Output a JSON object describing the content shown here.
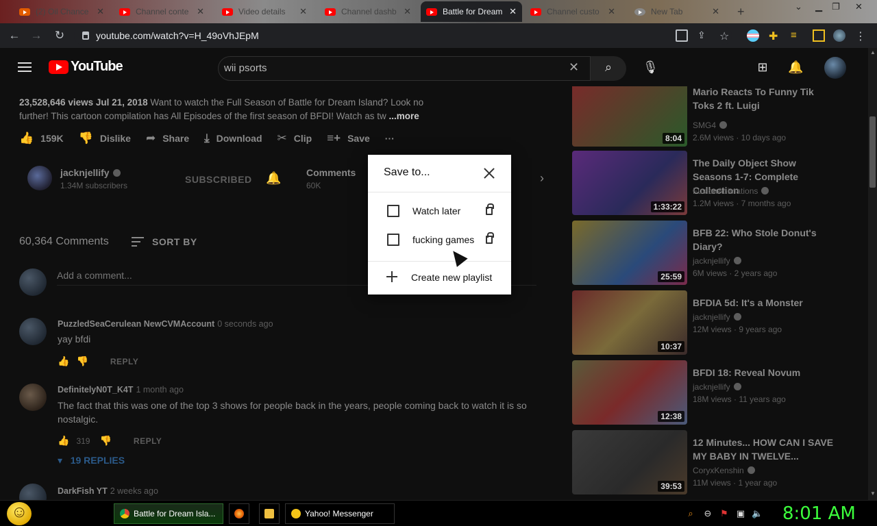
{
  "browser": {
    "tabs": [
      {
        "label": "(2) Oil Chance",
        "active": false
      },
      {
        "label": "Channel conte",
        "active": false
      },
      {
        "label": "Video details",
        "active": false
      },
      {
        "label": "Channel dashb",
        "active": false
      },
      {
        "label": "Battle for Dream",
        "active": true
      },
      {
        "label": "Channel custo",
        "active": false
      },
      {
        "label": "New Tab",
        "active": false
      }
    ],
    "new_tab_label": "+",
    "url": "youtube.com/watch?v=H_49oVhJEpM"
  },
  "header": {
    "logo_text": "YouTube",
    "search_value": "wii psorts"
  },
  "video": {
    "description_stats": "23,528,646 views  Jul 21, 2018",
    "description_text": "Want to watch the Full Season of Battle for Dream Island? Look no further! This cartoon compilation has All Episodes of the first season of BFDI! Watch as tw",
    "description_more": "...more",
    "actions": {
      "likes": "159K",
      "dislike": "Dislike",
      "share": "Share",
      "download": "Download",
      "clip": "Clip",
      "save": "Save",
      "more": "···"
    },
    "channel": {
      "name": "jacknjellify",
      "subscribers": "1.34M subscribers",
      "subscribed_label": "SUBSCRIBED"
    },
    "comments_chip": {
      "label": "Comments",
      "count": "60K"
    }
  },
  "comments": {
    "count_label": "60,364 Comments",
    "sort_label": "SORT BY",
    "add_placeholder": "Add a comment...",
    "items": [
      {
        "author": "PuzzledSeaCerulean NewCVMAccount",
        "time": "0 seconds ago",
        "text": "yay bfdi",
        "likes": "",
        "reply": "REPLY"
      },
      {
        "author": "DefinitelyN0T_K4T",
        "time": "1 month ago",
        "text": "The fact that this was one of the top 3 shows for people back in the years, people coming back to watch it is so nostalgic.",
        "likes": "319",
        "reply": "REPLY"
      },
      {
        "author": "DarkFish YT",
        "time": "2 weeks ago",
        "text": "",
        "likes": "",
        "reply": ""
      }
    ],
    "replies_toggle": "19 REPLIES"
  },
  "related": [
    {
      "title": "Mario Reacts To Funny Tik Toks 2 ft. Luigi",
      "channel": "SMG4",
      "meta": "2.6M views · 10 days ago",
      "duration": "8:04",
      "color": "#7a3a2a"
    },
    {
      "title": "The Daily Object Show Seasons 1-7: Complete Collection",
      "channel": "FusionAnimations",
      "meta": "1.2M views · 7 months ago",
      "duration": "1:33:22",
      "color": "#4a2a6a"
    },
    {
      "title": "BFB 22: Who Stole Donut's Diary?",
      "channel": "jacknjellify",
      "meta": "6M views · 2 years ago",
      "duration": "25:59",
      "color": "#7a6a2a"
    },
    {
      "title": "BFDIA 5d: It's a Monster",
      "channel": "jacknjellify",
      "meta": "12M views · 9 years ago",
      "duration": "10:37",
      "color": "#6a2a2a"
    },
    {
      "title": "BFDI 18: Reveal Novum",
      "channel": "jacknjellify",
      "meta": "18M views · 11 years ago",
      "duration": "12:38",
      "color": "#5a5a3a"
    },
    {
      "title": "12 Minutes... HOW CAN I SAVE MY BABY IN TWELVE...",
      "channel": "CoryxKenshin",
      "meta": "11M views · 1 year ago",
      "duration": "39:53",
      "color": "#3a3a3a"
    }
  ],
  "save_dialog": {
    "title": "Save to...",
    "playlists": [
      {
        "name": "Watch later",
        "checked": false
      },
      {
        "name": "fucking games",
        "checked": false
      }
    ],
    "create_label": "Create new playlist"
  },
  "taskbar": {
    "items": [
      {
        "label": "Battle for Dream Isla...",
        "active": true
      },
      {
        "label": "Yahoo! Messenger",
        "active": false
      }
    ],
    "clock": "8:01 AM"
  }
}
